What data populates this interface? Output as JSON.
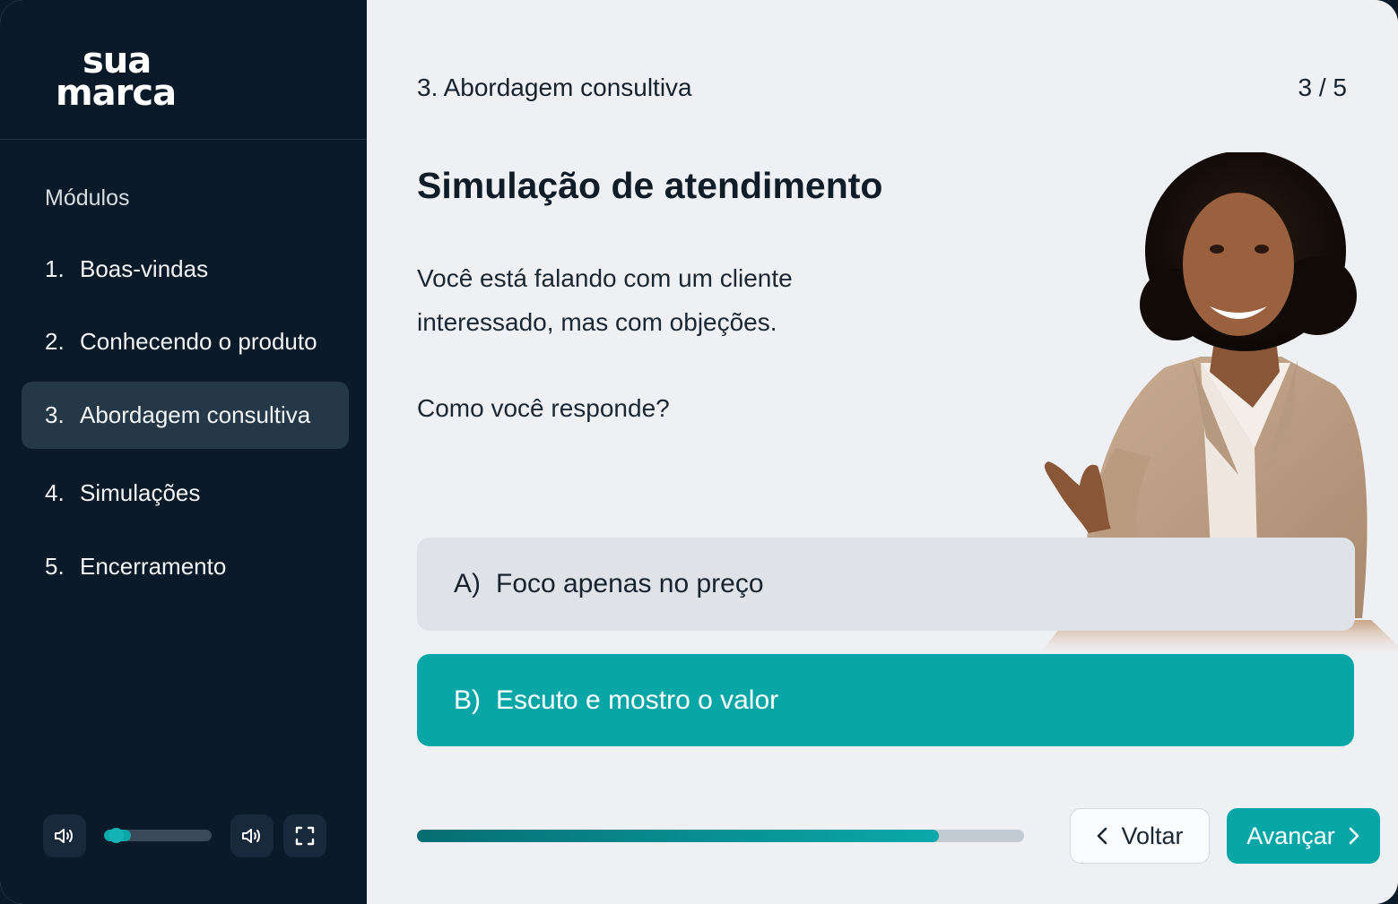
{
  "brand": {
    "line1": "sua",
    "line2": "marca"
  },
  "sidebar": {
    "title": "Módulos",
    "items": [
      {
        "number": "1.",
        "label": "Boas-vindas"
      },
      {
        "number": "2.",
        "label": "Conhecendo o produto"
      },
      {
        "number": "3.",
        "label": "Abordagem consultiva",
        "active": true
      },
      {
        "number": "4.",
        "label": "Simulações"
      },
      {
        "number": "5.",
        "label": "Encerramento"
      }
    ],
    "controls": {
      "volume_level": 0.25,
      "icons": [
        "speaker-icon",
        "volume-slider",
        "speaker-icon",
        "fullscreen-icon"
      ]
    }
  },
  "header": {
    "breadcrumb": "3. Abordagem consultiva",
    "counter": "3 / 5"
  },
  "main": {
    "heading": "Simulação de atendimento",
    "prompt": "Você está falando com um cliente interessado, mas com objeções.",
    "question": "Como você responde?",
    "options": [
      {
        "letter": "A)",
        "label": "Foco apenas no preço",
        "selected": false
      },
      {
        "letter": "B)",
        "label": "Escuto e mostro o valor",
        "selected": true
      }
    ],
    "progress": 0.86
  },
  "footer": {
    "back_label": "Voltar",
    "next_label": "Avançar"
  },
  "colors": {
    "accent": "#08a6a6",
    "sidebar_bg": "#0b1a28",
    "active_item_bg": "#243847",
    "main_bg": "#eef0f3"
  }
}
